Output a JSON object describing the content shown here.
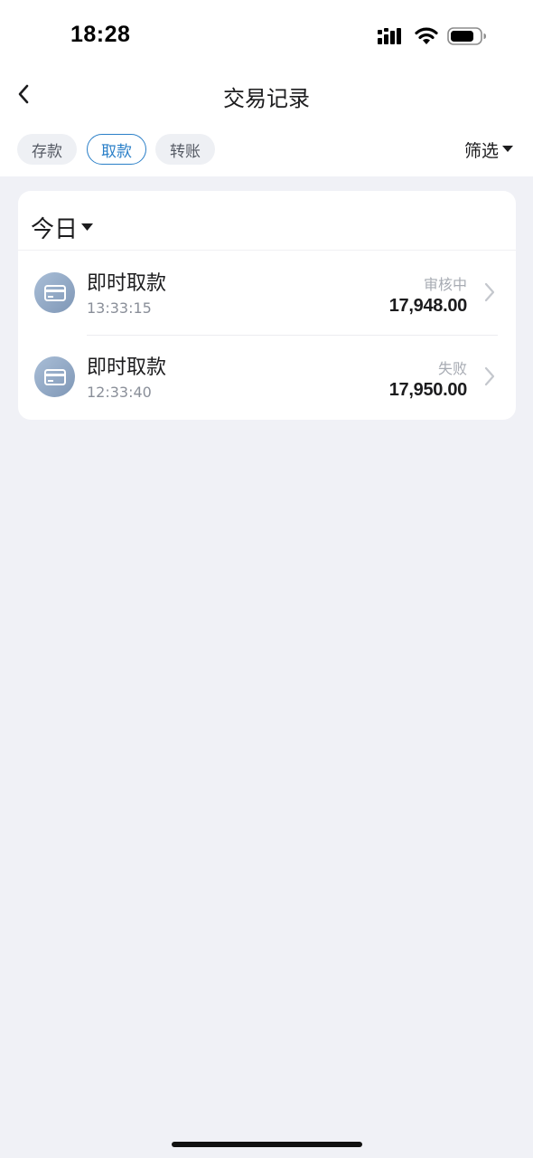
{
  "status_bar": {
    "time": "18:28",
    "icons": [
      "signal-icon",
      "wifi-icon",
      "battery-icon"
    ]
  },
  "nav": {
    "back_icon": "chevron-left-icon",
    "title": "交易记录"
  },
  "tabs": [
    {
      "label": "存款",
      "active": false
    },
    {
      "label": "取款",
      "active": true
    },
    {
      "label": "转账",
      "active": false
    }
  ],
  "filter": {
    "label": "筛选",
    "icon": "caret-down-icon"
  },
  "date_filter": {
    "label": "今日",
    "icon": "caret-down-icon"
  },
  "transactions": [
    {
      "icon": "card-icon",
      "title": "即时取款",
      "time": "13:33:15",
      "status": "审核中",
      "amount": "17,948.00"
    },
    {
      "icon": "card-icon",
      "title": "即时取款",
      "time": "12:33:40",
      "status": "失败",
      "amount": "17,950.00"
    }
  ],
  "colors": {
    "accent": "#2a7fc8",
    "background": "#f0f1f6",
    "card": "#ffffff",
    "icon_gradient_start": "#a9bed7",
    "icon_gradient_end": "#7f97b6"
  }
}
